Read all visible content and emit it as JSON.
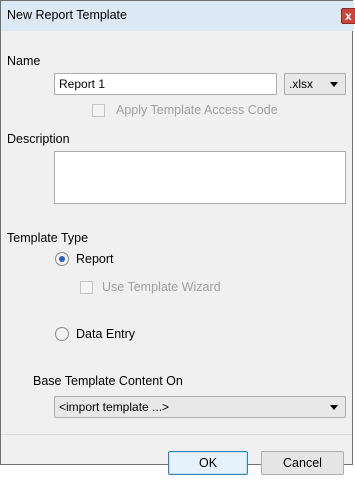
{
  "window": {
    "title": "New Report Template",
    "close_label": "x"
  },
  "name_section": {
    "label": "Name",
    "name_value": "Report 1",
    "format_value": ".xlsx",
    "access_code_label": "Apply Template Access Code"
  },
  "description_section": {
    "label": "Description",
    "value": ""
  },
  "template_type": {
    "label": "Template Type",
    "report_label": "Report",
    "wizard_label": "Use Template Wizard",
    "data_entry_label": "Data Entry",
    "selected": "Report"
  },
  "base_template": {
    "label": "Base Template Content On",
    "value": "<import template ...>"
  },
  "buttons": {
    "ok": "OK",
    "cancel": "Cancel"
  }
}
